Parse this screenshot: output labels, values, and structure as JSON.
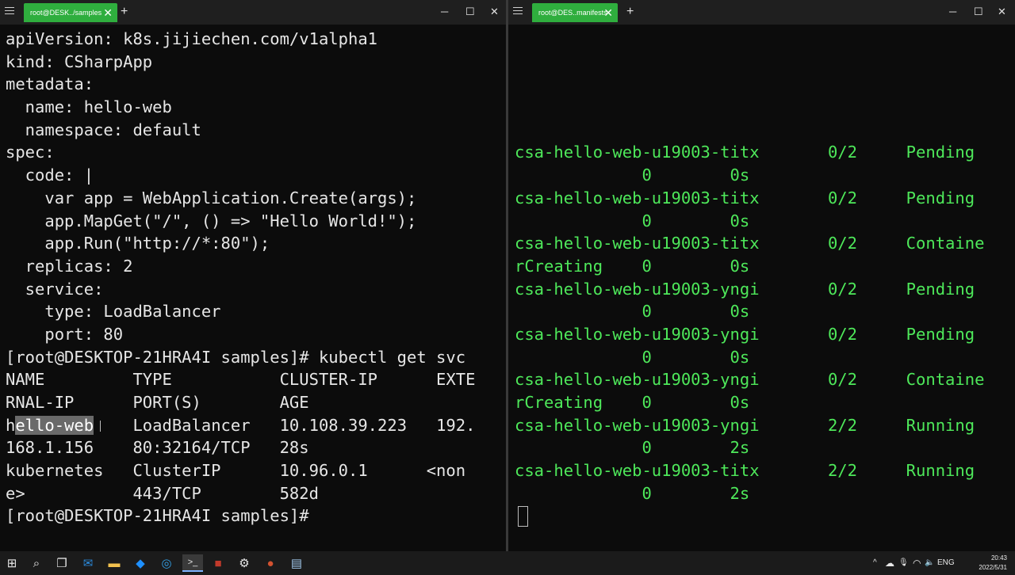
{
  "left_window": {
    "tab_title": "root@DESK../samples",
    "tab_close": "✕",
    "new_tab": "+",
    "controls": {
      "minimize": "─",
      "maximize": "☐",
      "close": "✕"
    },
    "lines": [
      "apiVersion: k8s.jijiechen.com/v1alpha1",
      "kind: CSharpApp",
      "metadata:",
      "  name: hello-web",
      "  namespace: default",
      "spec:",
      "  code: |",
      "    var app = WebApplication.Create(args);",
      "    app.MapGet(\"/\", () => \"Hello World!\");",
      "    app.Run(\"http://*:80\");",
      "  replicas: 2",
      "  service:",
      "    type: LoadBalancer",
      "    port: 80",
      "[root@DESKTOP-21HRA4I samples]# kubectl get svc",
      "NAME         TYPE           CLUSTER-IP      EXTE",
      "RNAL-IP      PORT(S)        AGE",
      "",
      "168.1.156    80:32164/TCP   28s",
      "kubernetes   ClusterIP      10.96.0.1      <non",
      "e>           443/TCP        582d",
      "[root@DESKTOP-21HRA4I samples]#"
    ],
    "svc_row": {
      "pre": "h",
      "selected": "ello-web",
      "post": "    LoadBalancer   10.108.39.223   192."
    }
  },
  "right_window": {
    "tab_title": "root@DES..manifests",
    "tab_close": "✕",
    "new_tab": "+",
    "controls": {
      "minimize": "─",
      "maximize": "☐",
      "close": "✕"
    },
    "lines": [
      "",
      "",
      "",
      "",
      "",
      "csa-hello-web-u19003-titx       0/2     Pending",
      "             0        0s",
      "csa-hello-web-u19003-titx       0/2     Pending",
      "             0        0s",
      "csa-hello-web-u19003-titx       0/2     Containe",
      "rCreating    0        0s",
      "csa-hello-web-u19003-yngi       0/2     Pending",
      "             0        0s",
      "csa-hello-web-u19003-yngi       0/2     Pending",
      "             0        0s",
      "csa-hello-web-u19003-yngi       0/2     Containe",
      "rCreating    0        0s",
      "csa-hello-web-u19003-yngi       2/2     Running",
      "             0        2s",
      "csa-hello-web-u19003-titx       2/2     Running",
      "             0        2s"
    ]
  },
  "taskbar": {
    "icons": [
      {
        "name": "windows-start-icon",
        "glyph": "⊞",
        "color": "#ffffff"
      },
      {
        "name": "search-icon",
        "glyph": "⌕",
        "color": "#ffffff"
      },
      {
        "name": "task-view-icon",
        "glyph": "❐",
        "color": "#ffffff"
      },
      {
        "name": "mail-icon",
        "glyph": "✉",
        "color": "#2b88d8"
      },
      {
        "name": "file-explorer-icon",
        "glyph": "▬",
        "color": "#f2c14e"
      },
      {
        "name": "app-icon",
        "glyph": "◆",
        "color": "#1e90ff"
      },
      {
        "name": "edge-browser-icon",
        "glyph": "◎",
        "color": "#34a0e6"
      },
      {
        "name": "terminal-icon",
        "glyph": ">_",
        "color": "#ffffff"
      },
      {
        "name": "red-app-icon",
        "glyph": "■",
        "color": "#c23a2b"
      },
      {
        "name": "settings-gear-icon",
        "glyph": "⚙",
        "color": "#ffffff"
      },
      {
        "name": "powerpoint-icon",
        "glyph": "●",
        "color": "#d35230"
      },
      {
        "name": "notepad-icon",
        "glyph": "▤",
        "color": "#9fc5e8"
      }
    ],
    "tray": {
      "chevron": "^",
      "cloud": "☁",
      "mic": "🎙",
      "wifi": "◠",
      "volume": "🔈",
      "battery": "▭",
      "lang": "ENG",
      "time": "20:43",
      "date": "2022/5/31"
    }
  }
}
